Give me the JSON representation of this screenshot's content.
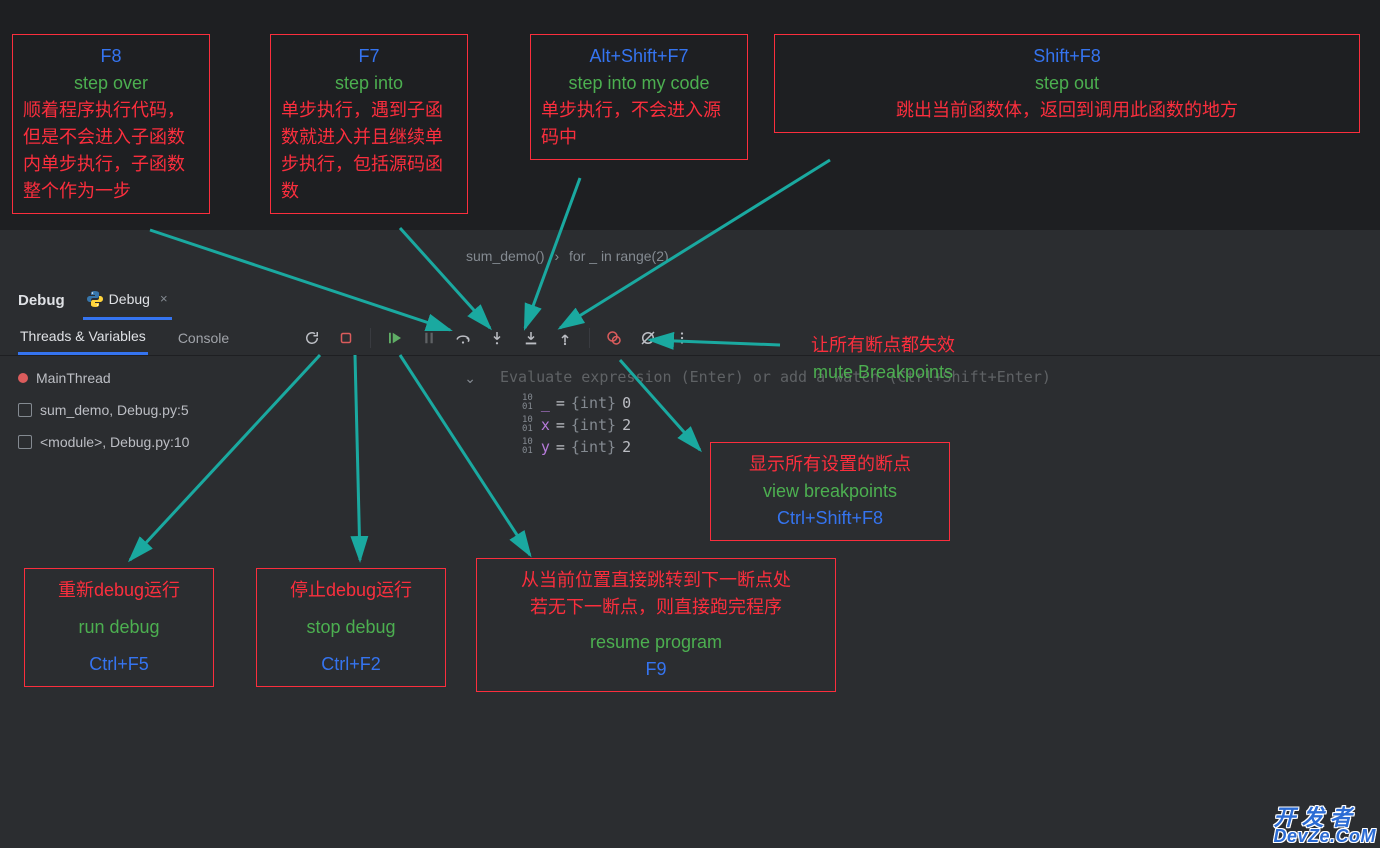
{
  "breadcrumb": {
    "a": "sum_demo()",
    "b": "for _ in range(2)"
  },
  "header": {
    "title": "Debug",
    "tab_label": "Debug",
    "close": "×"
  },
  "subtabs": {
    "threads": "Threads & Variables",
    "console": "Console"
  },
  "threads": {
    "main": "MainThread",
    "frame1": "sum_demo, Debug.py:5",
    "frame2": "<module>, Debug.py:10",
    "chev": "⌄"
  },
  "eval_hint": "Evaluate expression (Enter) or add a watch (Ctrl+Shift+Enter)",
  "vars": [
    {
      "name": "_",
      "type": "{int}",
      "val": "0"
    },
    {
      "name": "x",
      "type": "{int}",
      "val": "2"
    },
    {
      "name": "y",
      "type": "{int}",
      "val": "2"
    }
  ],
  "anno": {
    "f8": {
      "key": "F8",
      "name": "step over",
      "desc": "顺着程序执行代码，但是不会进入子函数内单步执行，子函数整个作为一步"
    },
    "f7": {
      "key": "F7",
      "name": "step into",
      "desc": "单步执行，遇到子函数就进入并且继续单步执行，包括源码函数"
    },
    "altf7": {
      "key": "Alt+Shift+F7",
      "name": "step into my code",
      "desc": "单步执行，不会进入源码中"
    },
    "shiftf8": {
      "key": "Shift+F8",
      "name": "step out",
      "desc": "跳出当前函数体，返回到调用此函数的地方"
    },
    "mute": {
      "desc": "让所有断点都失效",
      "name": "mute Breakpoints"
    },
    "viewbp": {
      "desc": "显示所有设置的断点",
      "name": "view breakpoints",
      "key": "Ctrl+Shift+F8"
    },
    "rundbg": {
      "desc": "重新debug运行",
      "name": "run debug",
      "key": "Ctrl+F5"
    },
    "stopdbg": {
      "desc": "停止debug运行",
      "name": "stop debug",
      "key": "Ctrl+F2"
    },
    "resume": {
      "desc1": "从当前位置直接跳转到下一断点处",
      "desc2": "若无下一断点，则直接跑完程序",
      "name": "resume program",
      "key": "F9"
    }
  },
  "watermark": {
    "l1": "开 发 者",
    "l2": "DevZe.CoM"
  }
}
